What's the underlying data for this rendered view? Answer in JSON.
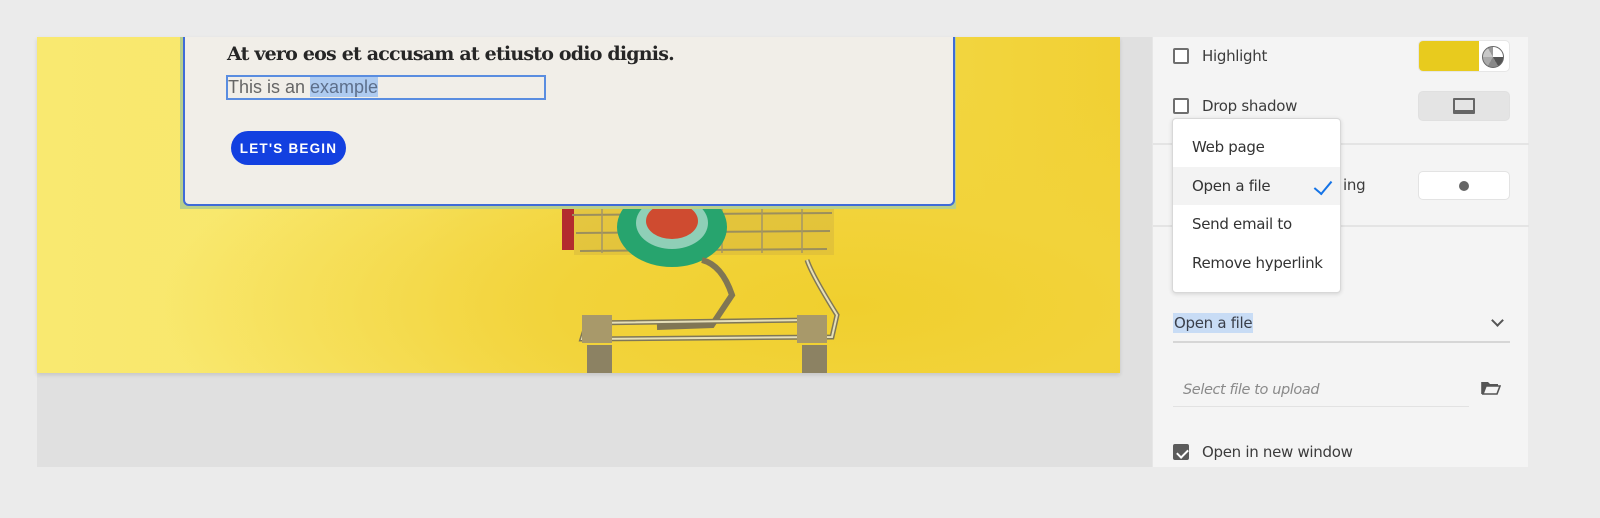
{
  "canvas": {
    "card": {
      "title": "At vero eos et accusam at etiusto odio dignis.",
      "input_text_plain": "This is an ",
      "input_text_selected": "example",
      "button_label": "LET'S BEGIN"
    },
    "hero_image": {
      "alt": "Miniature shopping cart on yellow background"
    }
  },
  "panel": {
    "highlight": {
      "label": "Highlight",
      "checked": false,
      "color": "#e8cb1e"
    },
    "drop_shadow": {
      "label": "Drop shadow",
      "checked": false
    },
    "partial_label": "ing",
    "link_type_select": {
      "value": "Open a file"
    },
    "file_field": {
      "placeholder": "Select file to upload"
    },
    "open_new_window": {
      "label": "Open in new window",
      "checked": true
    }
  },
  "menu": {
    "items": [
      {
        "label": "Web page",
        "selected": false
      },
      {
        "label": "Open a file",
        "selected": true
      },
      {
        "label": "Send email to",
        "selected": false
      },
      {
        "label": "Remove hyperlink",
        "selected": false
      }
    ]
  },
  "colors": {
    "accent": "#1473e6",
    "button": "#1340e0",
    "selection": "#c8dcf5"
  }
}
